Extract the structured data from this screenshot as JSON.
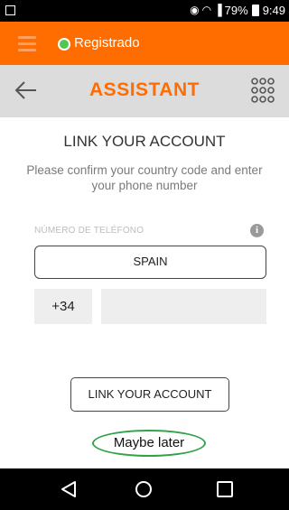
{
  "status_bar": {
    "battery": "79%",
    "time": "9:49"
  },
  "top_bar": {
    "status": "Registrado",
    "accent_color": "#ff6d00",
    "status_dot_color": "#50c850"
  },
  "header": {
    "title": "ASSISTANT",
    "back_icon": "arrow-left-icon",
    "menu_icon": "grid-dots-icon"
  },
  "main": {
    "heading": "LINK YOUR ACCOUNT",
    "description": "Please confirm your country code and enter your phone number",
    "phone_label": "NÚMERO DE TELÉFONO",
    "country": "SPAIN",
    "country_code": "+34",
    "phone_value": "",
    "link_button": "LINK YOUR ACCOUNT",
    "maybe_later": "Maybe later"
  }
}
